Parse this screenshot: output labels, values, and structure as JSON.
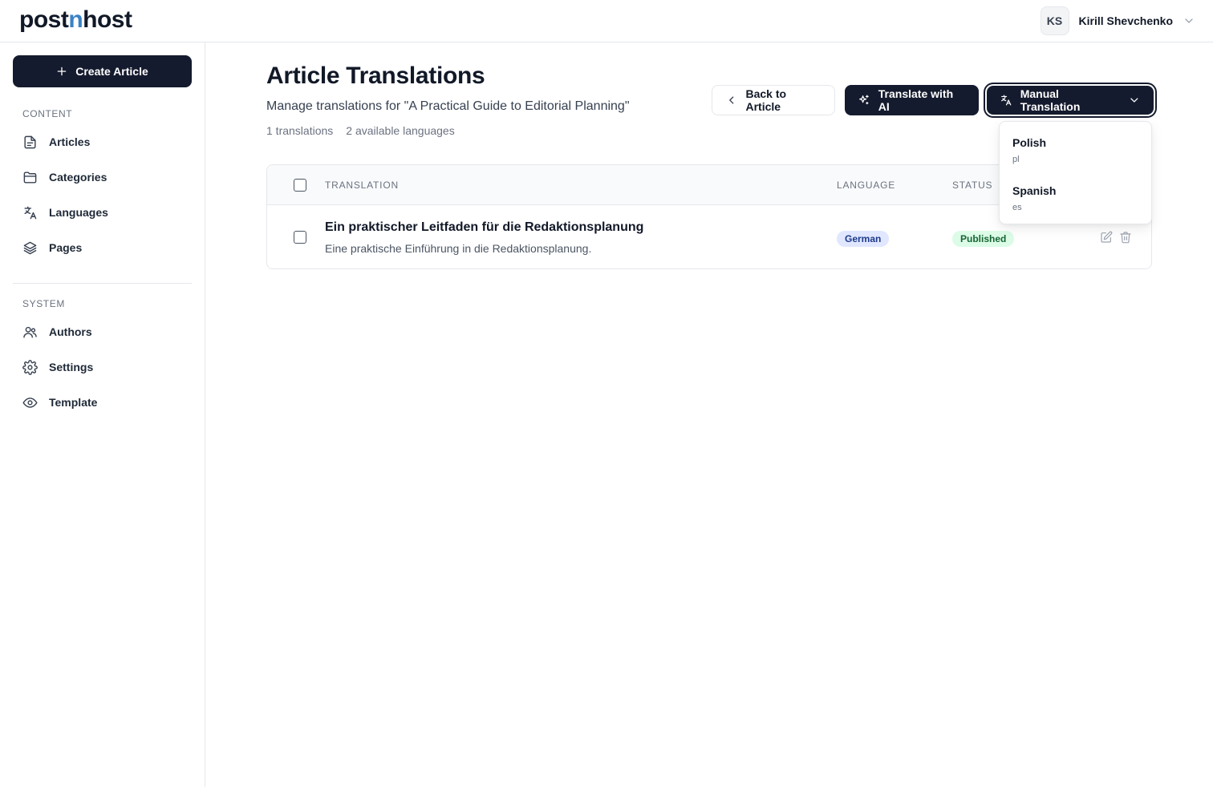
{
  "app": {
    "logo_pre": "post",
    "logo_accent": "n",
    "logo_post": "host"
  },
  "user": {
    "initials": "KS",
    "name": "Kirill Shevchenko"
  },
  "sidebar": {
    "create_label": "Create Article",
    "content_label": "CONTENT",
    "system_label": "SYSTEM",
    "content_items": [
      {
        "label": "Articles",
        "icon": "file-icon"
      },
      {
        "label": "Categories",
        "icon": "folder-icon"
      },
      {
        "label": "Languages",
        "icon": "translate-icon"
      },
      {
        "label": "Pages",
        "icon": "layers-icon"
      }
    ],
    "system_items": [
      {
        "label": "Authors",
        "icon": "users-icon"
      },
      {
        "label": "Settings",
        "icon": "gear-icon"
      },
      {
        "label": "Template",
        "icon": "eye-icon"
      }
    ]
  },
  "main": {
    "title": "Article Translations",
    "subtitle": "Manage translations for \"A Practical Guide to Editorial Planning\"",
    "translations_count": "1 translations",
    "available_languages": "2 available languages",
    "back_label": "Back to Article",
    "ai_label": "Translate with AI",
    "manual_label": "Manual Translation"
  },
  "table": {
    "headers": {
      "translation": "TRANSLATION",
      "language": "LANGUAGE",
      "status": "STATUS"
    },
    "rows": [
      {
        "title": "Ein praktischer Leitfaden für die Redaktionsplanung",
        "description": "Eine praktische Einführung in die Redaktionsplanung.",
        "language": "German",
        "status": "Published"
      }
    ]
  },
  "dropdown": {
    "options": [
      {
        "name": "Polish",
        "code": "pl"
      },
      {
        "name": "Spanish",
        "code": "es"
      }
    ]
  },
  "colors": {
    "primary_dark": "#151b2e",
    "logo_accent": "#3b82c4",
    "language_badge_bg": "#e0e7ff",
    "status_badge_bg": "#dcfce7"
  }
}
